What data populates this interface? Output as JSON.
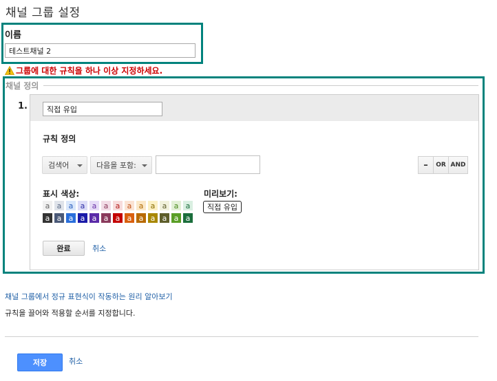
{
  "page": {
    "title": "채널 그룹 설정"
  },
  "name_section": {
    "label": "이름",
    "value": "테스트채널 2"
  },
  "warning": {
    "text": "그룹에 대한 규칙을 하나 이상 지정하세요."
  },
  "channel_definition": {
    "legend": "채널 정의",
    "rule": {
      "number": "1.",
      "name_value": "직접 유입",
      "section_title": "규칙 정의",
      "dimension_dropdown": "검색어",
      "operator_dropdown": "다음을 포함:",
      "match_value": "",
      "buttons": {
        "remove": "–",
        "or": "OR",
        "and": "AND"
      },
      "color_label": "표시 색상:",
      "preview_label": "미리보기:",
      "preview_text": "직접 유입",
      "swatch_letter": "a",
      "light_swatches": [
        {
          "bg": "#f0f0f0",
          "fg": "#666666"
        },
        {
          "bg": "#dfe3ea",
          "fg": "#5a6a85"
        },
        {
          "bg": "#d9e7fb",
          "fg": "#2a5fbf"
        },
        {
          "bg": "#dcdcf7",
          "fg": "#2e2ea8"
        },
        {
          "bg": "#e6dcf7",
          "fg": "#6a32a8"
        },
        {
          "bg": "#f2dce6",
          "fg": "#8a3a5c"
        },
        {
          "bg": "#f7dcdc",
          "fg": "#b31b1b"
        },
        {
          "bg": "#fbe3d3",
          "fg": "#c2551a"
        },
        {
          "bg": "#fbe8c8",
          "fg": "#b06a00"
        },
        {
          "bg": "#fbf0c4",
          "fg": "#8a6d00"
        },
        {
          "bg": "#f1f1dc",
          "fg": "#5e5e2a"
        },
        {
          "bg": "#e2f0d6",
          "fg": "#4b8a1e"
        },
        {
          "bg": "#d9efe1",
          "fg": "#1b6e3c"
        }
      ],
      "dark_swatches": [
        {
          "bg": "#333333",
          "fg": "#ffffff"
        },
        {
          "bg": "#4b5a78",
          "fg": "#ffffff"
        },
        {
          "bg": "#2a6fdb",
          "fg": "#ffffff"
        },
        {
          "bg": "#1a1aa8",
          "fg": "#ffffff"
        },
        {
          "bg": "#5a2aa8",
          "fg": "#ffffff"
        },
        {
          "bg": "#8a3a5c",
          "fg": "#ffffff"
        },
        {
          "bg": "#c40000",
          "fg": "#ffffff"
        },
        {
          "bg": "#d9600f",
          "fg": "#ffffff"
        },
        {
          "bg": "#b86a00",
          "fg": "#ffffff"
        },
        {
          "bg": "#a88700",
          "fg": "#ffffff"
        },
        {
          "bg": "#5e5e2a",
          "fg": "#ffffff"
        },
        {
          "bg": "#5a9e26",
          "fg": "#ffffff"
        },
        {
          "bg": "#1b6e3c",
          "fg": "#ffffff"
        }
      ],
      "done_label": "완료",
      "cancel_label": "취소"
    }
  },
  "help": {
    "regex_link": "채널 그룹에서 정규 표현식이 작동하는 원리 알아보기",
    "drag_text": "규칙을 끌어와 적용할 순서를 지정합니다."
  },
  "footer": {
    "save_label": "저장",
    "cancel_label": "취소"
  },
  "colors": {
    "accent_border": "#00827c",
    "warning": "#cc0000",
    "link": "#1f5fa6",
    "primary_button": "#4d90fe"
  }
}
